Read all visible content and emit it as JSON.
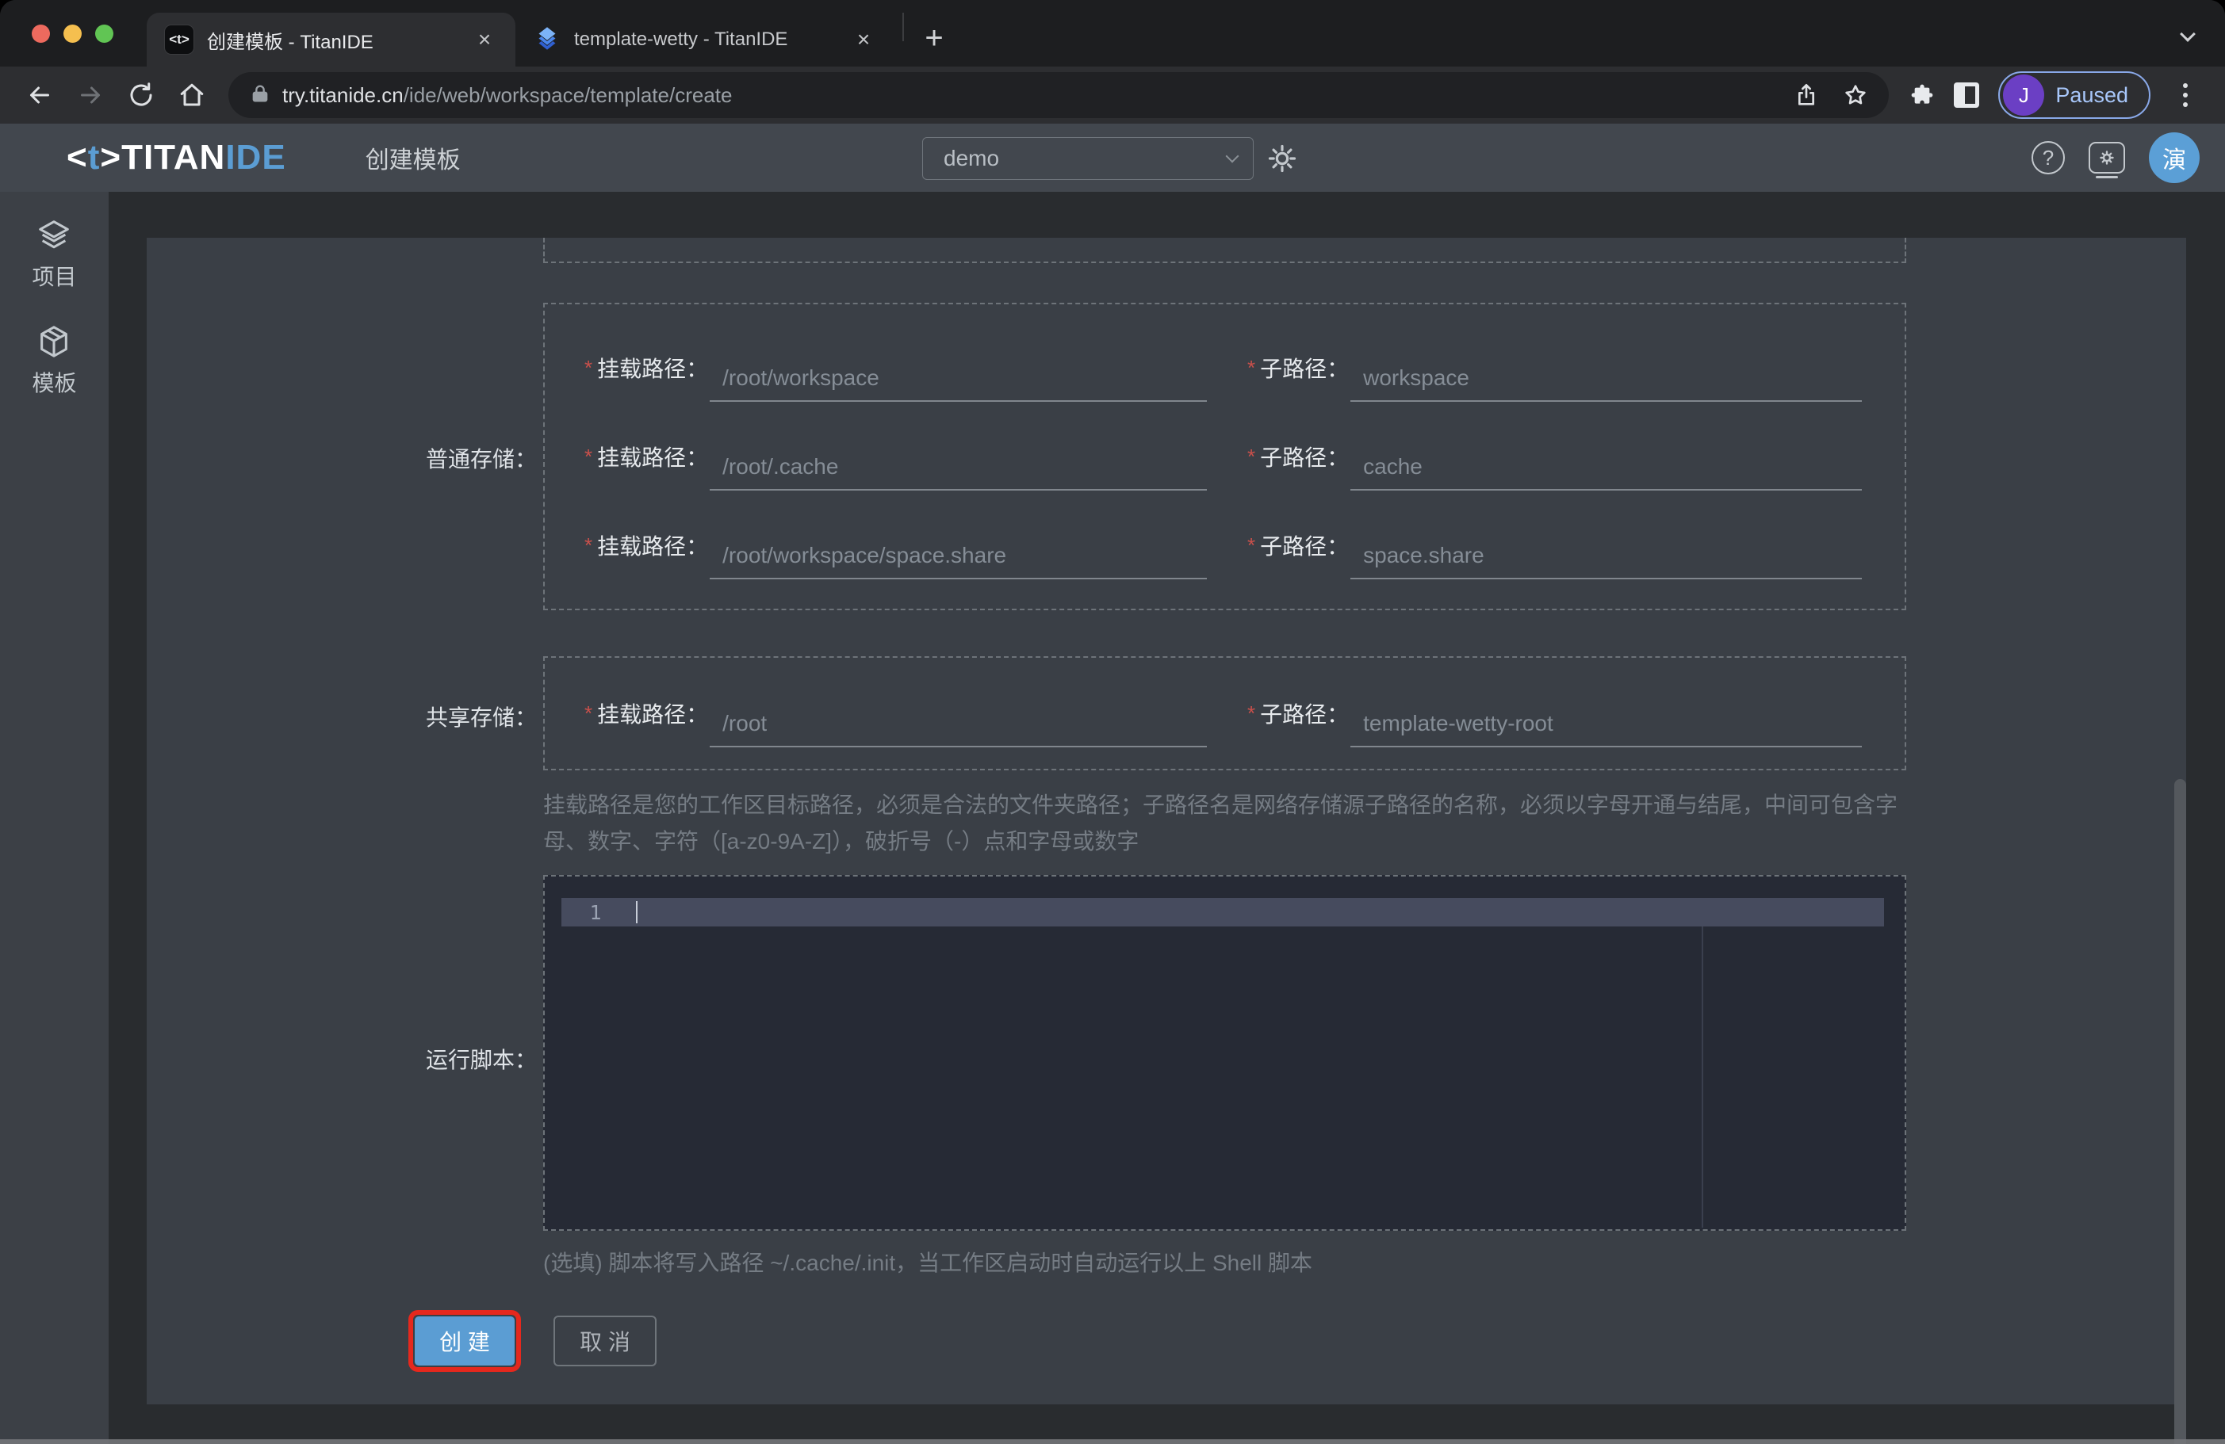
{
  "browser": {
    "tabs": [
      {
        "title": "创建模板 - TitanIDE"
      },
      {
        "title": "template-wetty - TitanIDE"
      }
    ],
    "tab_icon_glyph": "<t>",
    "url_domain": "try.titanide.cn",
    "url_path": "/ide/web/workspace/template/create",
    "profile": {
      "initial": "J",
      "status": "Paused"
    }
  },
  "icons": {
    "close": "×",
    "plus": "+",
    "question": "?"
  },
  "app_header": {
    "logo_bracket_l": "<",
    "logo_t": "t",
    "logo_bracket_r": ">",
    "logo_titan": "TITAN",
    "logo_ide": "IDE",
    "page_title": "创建模板",
    "workspace_selected": "demo",
    "avatar_text": "演"
  },
  "sidebar": {
    "items": [
      {
        "label": "项目"
      },
      {
        "label": "模板"
      }
    ]
  },
  "form": {
    "normal_storage_label": "普通存储：",
    "shared_storage_label": "共享存储：",
    "mount_label": "挂载路径：",
    "sub_label": "子路径：",
    "required_mark": "*",
    "normal_rows": [
      {
        "mount": "/root/workspace",
        "sub": "workspace"
      },
      {
        "mount": "/root/.cache",
        "sub": "cache"
      },
      {
        "mount": "/root/workspace/space.share",
        "sub": "space.share"
      }
    ],
    "shared_rows": [
      {
        "mount": "/root",
        "sub": "template-wetty-root"
      }
    ],
    "path_help": "挂载路径是您的工作区目标路径，必须是合法的文件夹路径；子路径名是网络存储源子路径的名称，必须以字母开通与结尾，中间可包含字母、数字、字符（[a-z0-9A-Z]），破折号（-）点和字母或数字",
    "script_label": "运行脚本：",
    "editor": {
      "line_number": "1"
    },
    "script_help": "(选填) 脚本将写入路径 ~/.cache/.init，当工作区启动时自动运行以上 Shell 脚本",
    "create_label": "创 建",
    "cancel_label": "取 消"
  },
  "colors": {
    "accent_blue": "#5b9dd3",
    "annotation_red": "#e5281d",
    "avatar_purple": "#6b3fc4",
    "header_bg": "#42474e",
    "card_bg": "#3a3f46",
    "editor_bg": "#262a35"
  }
}
